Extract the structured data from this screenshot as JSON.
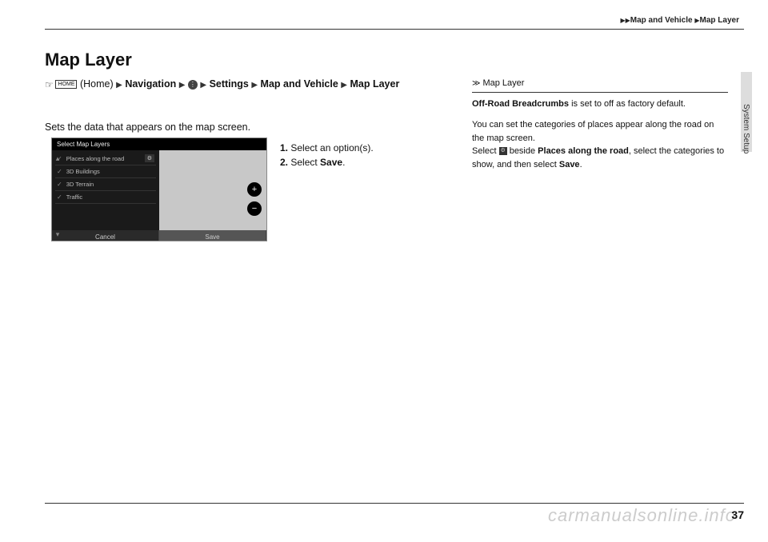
{
  "breadcrumb": {
    "section": "Map and Vehicle",
    "page": "Map Layer"
  },
  "side_label": "System Setup",
  "title": "Map Layer",
  "nav_path": {
    "home_text": "(Home)",
    "home_icon_label": "HOME",
    "items": [
      "Navigation",
      "Settings",
      "Map and Vehicle",
      "Map Layer"
    ]
  },
  "description": "Sets the data that appears on the map screen.",
  "screenshot": {
    "title": "Select Map Layers",
    "options": [
      "Places along the road",
      "3D Buildings",
      "3D Terrain",
      "Traffic"
    ],
    "cancel": "Cancel",
    "save": "Save"
  },
  "steps": {
    "s1_num": "1.",
    "s1_text": "Select an option(s).",
    "s2_num": "2.",
    "s2_text_a": "Select ",
    "s2_text_b": "Save",
    "s2_text_c": "."
  },
  "right": {
    "header": "Map Layer",
    "p1_a": "Off-Road Breadcrumbs",
    "p1_b": " is set to off as factory default.",
    "p2": "You can set the categories of places appear along the road on the map screen.",
    "p3_a": "Select ",
    "p3_b": " beside ",
    "p3_c": "Places along the road",
    "p3_d": ", select the categories to show, and then select ",
    "p3_e": "Save",
    "p3_f": "."
  },
  "watermark": "carmanualsonline.info",
  "page_number": "37"
}
